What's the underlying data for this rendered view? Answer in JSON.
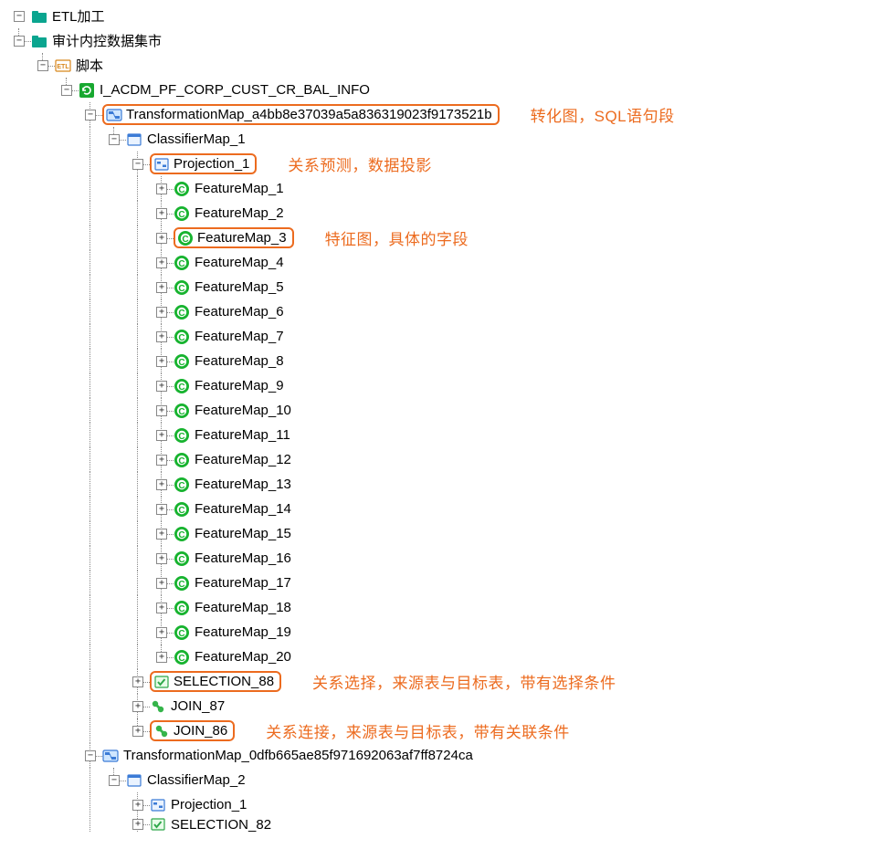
{
  "root": {
    "label": "ETL加工"
  },
  "mart": {
    "label": "审计内控数据集市"
  },
  "script": {
    "label": "脚本"
  },
  "proc": {
    "label": "I_ACDM_PF_CORP_CUST_CR_BAL_INFO"
  },
  "tmap1": {
    "label": "TransformationMap_a4bb8e37039a5a836319023f9173521b"
  },
  "cmap1": {
    "label": "ClassifierMap_1"
  },
  "proj1": {
    "label": "Projection_1"
  },
  "features": [
    "FeatureMap_1",
    "FeatureMap_2",
    "FeatureMap_3",
    "FeatureMap_4",
    "FeatureMap_5",
    "FeatureMap_6",
    "FeatureMap_7",
    "FeatureMap_8",
    "FeatureMap_9",
    "FeatureMap_10",
    "FeatureMap_11",
    "FeatureMap_12",
    "FeatureMap_13",
    "FeatureMap_14",
    "FeatureMap_15",
    "FeatureMap_16",
    "FeatureMap_17",
    "FeatureMap_18",
    "FeatureMap_19",
    "FeatureMap_20"
  ],
  "feature_hl_index": 2,
  "sel88": {
    "label": "SELECTION_88"
  },
  "join87": {
    "label": "JOIN_87"
  },
  "join86": {
    "label": "JOIN_86"
  },
  "tmap2": {
    "label": "TransformationMap_0dfb665ae85f971692063af7ff8724ca"
  },
  "cmap2": {
    "label": "ClassifierMap_2"
  },
  "proj2": {
    "label": "Projection_1"
  },
  "sel82": {
    "label": "SELECTION_82"
  },
  "annotations": {
    "tmap": "转化图，SQL语句段",
    "proj": "关系预测，数据投影",
    "feature": "特征图，具体的字段",
    "selection": "关系选择，来源表与目标表，带有选择条件",
    "join": "关系连接，来源表与目标表，带有关联条件"
  }
}
